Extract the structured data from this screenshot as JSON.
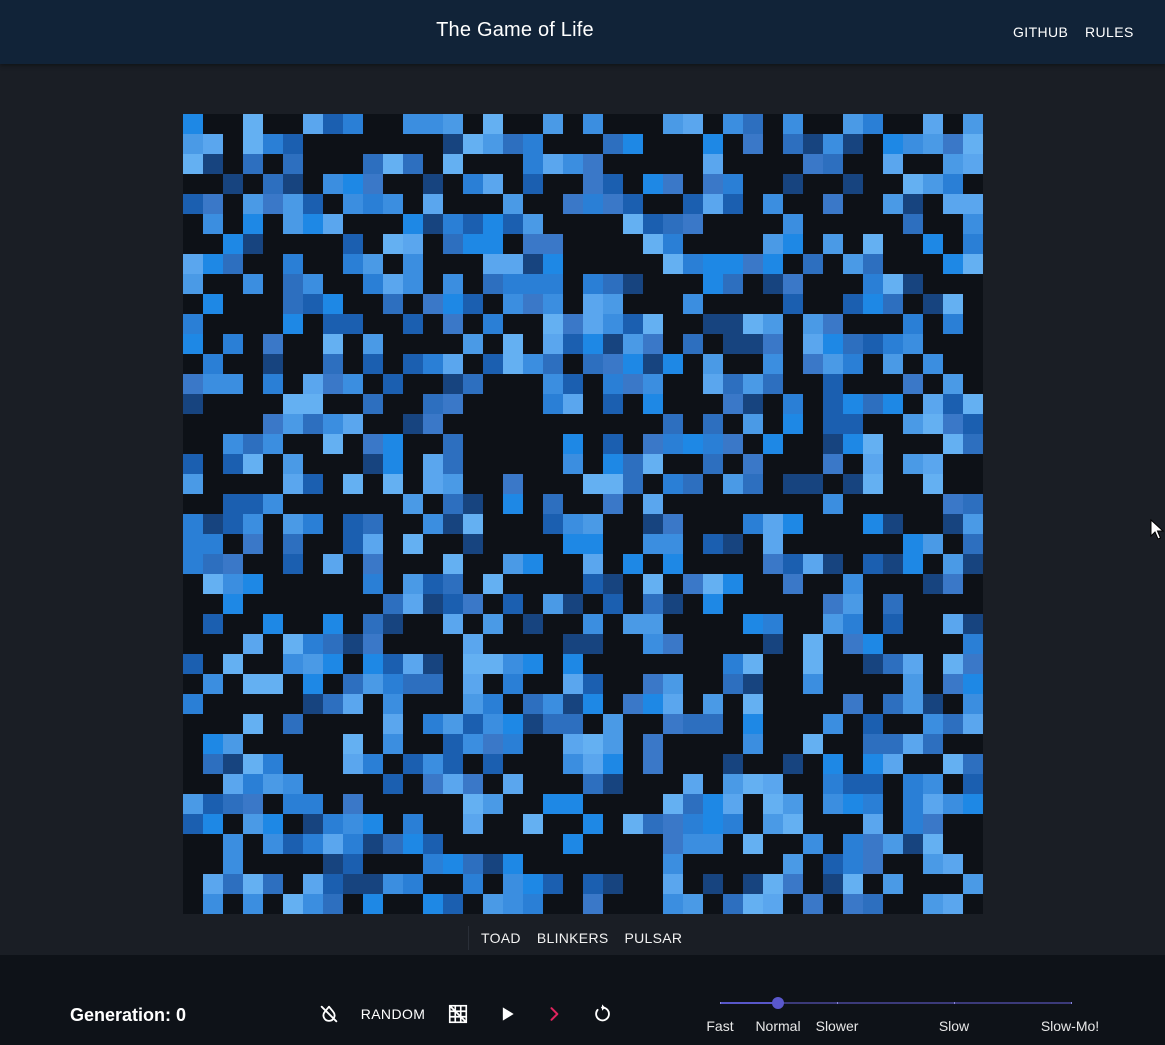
{
  "header": {
    "title": "The Game of Life",
    "nav": [
      "GITHUB",
      "RULES"
    ]
  },
  "board": {
    "rows": 40,
    "cols": 40,
    "alive_density": 0.5,
    "palette": [
      "#1b5fb0",
      "#2a7fd6",
      "#3b8ee0",
      "#4a9ae6",
      "#5aa6ee",
      "#2d6fbf",
      "#1e88e5",
      "#64b0f2",
      "#3a78c8",
      "#17447f"
    ],
    "dead_color": "#0d1117"
  },
  "presets": {
    "items": [
      "TOAD",
      "BLINKERS",
      "PULSAR"
    ]
  },
  "controls": {
    "generation_label": "Generation:",
    "generation_value": "0",
    "random_label": "RANDOM",
    "icons": [
      "invert-colors-off-icon",
      "grid-off-icon",
      "play-icon",
      "step-forward-icon",
      "reset-icon"
    ],
    "step_color": "#e0245e"
  },
  "speed": {
    "labels": [
      "Fast",
      "Normal",
      "Slower",
      "Slow",
      "Slow-Mo!"
    ],
    "selected": "Normal",
    "accent": "#5a58cc"
  }
}
